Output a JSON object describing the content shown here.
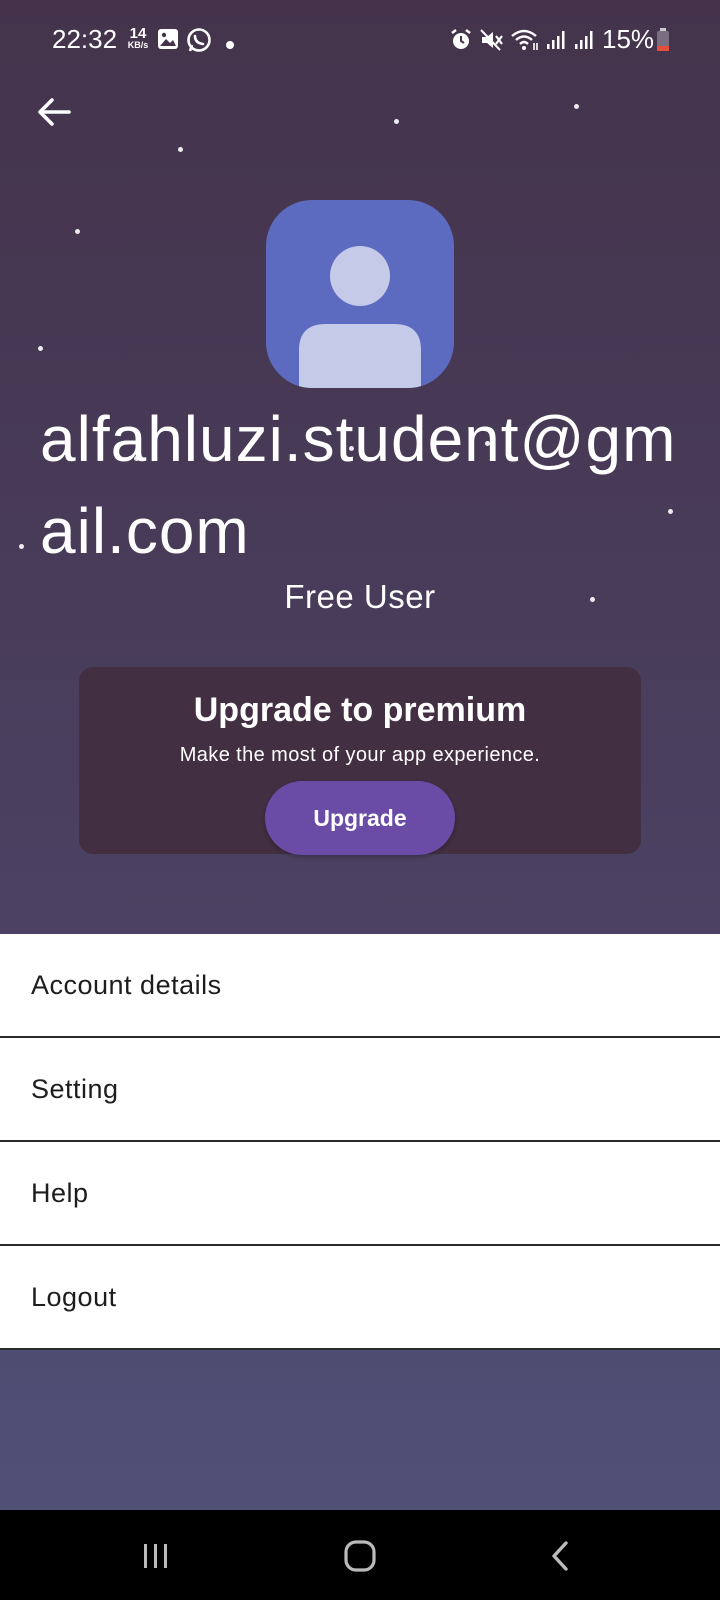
{
  "status_bar": {
    "time": "22:32",
    "speed_value": "14",
    "speed_unit": "KB/s",
    "battery": "15%"
  },
  "profile": {
    "email": "alfahluzi.student@gmail.com",
    "tier": "Free User"
  },
  "premium": {
    "title": "Upgrade to premium",
    "subtitle": "Make the most of your app experience.",
    "button_label": "Upgrade"
  },
  "menu": {
    "items": [
      {
        "label": "Account details"
      },
      {
        "label": "Setting"
      },
      {
        "label": "Help"
      },
      {
        "label": "Logout"
      }
    ]
  },
  "colors": {
    "avatar_bg": "#5c6bc0",
    "avatar_fg": "#c5cae9",
    "card_bg": "#422f42",
    "button_bg": "#6a4ba6"
  },
  "icons": [
    "back-arrow-icon",
    "gallery-icon",
    "whatsapp-icon",
    "alarm-icon",
    "mute-icon",
    "wifi-icon",
    "signal-icon",
    "battery-icon",
    "recent-apps-icon",
    "home-icon",
    "nav-back-icon"
  ]
}
